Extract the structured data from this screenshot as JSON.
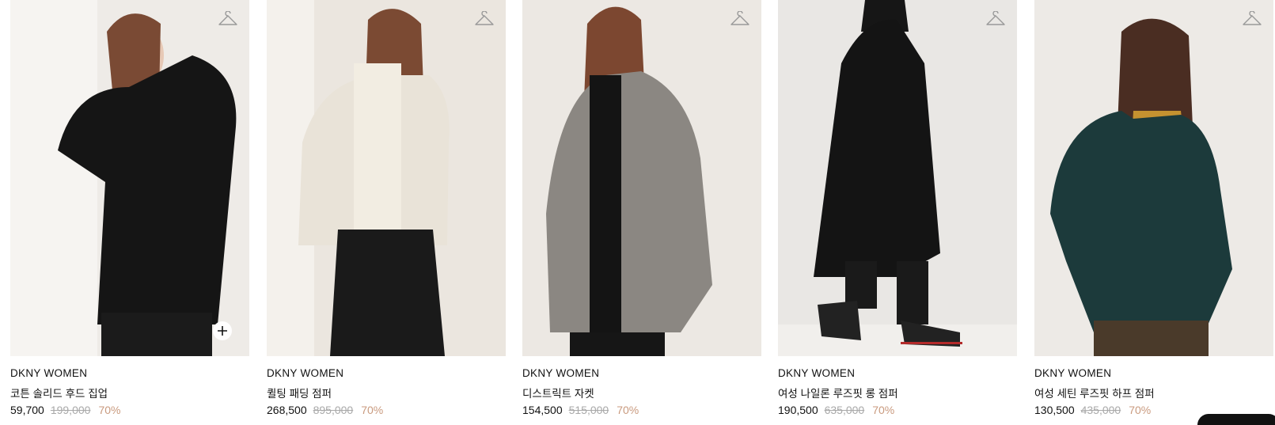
{
  "colors": {
    "sale_price": "#111111",
    "original_price": "#a9a9a9",
    "discount": "#c99a7e"
  },
  "icons": {
    "wishlist": "hanger-icon",
    "quick_add": "plus-icon"
  },
  "products": [
    {
      "brand": "DKNY WOMEN",
      "name": "코튼 솔리드 후드 집업",
      "sale_price": "59,700",
      "original_price": "199,000",
      "discount": "70%",
      "garment_color": "#151515"
    },
    {
      "brand": "DKNY WOMEN",
      "name": "퀼팅 패딩 점퍼",
      "sale_price": "268,500",
      "original_price": "895,000",
      "discount": "70%",
      "garment_color": "#e9e3d8"
    },
    {
      "brand": "DKNY WOMEN",
      "name": "디스트릭트 자켓",
      "sale_price": "154,500",
      "original_price": "515,000",
      "discount": "70%",
      "garment_color": "#8b8782"
    },
    {
      "brand": "DKNY WOMEN",
      "name": "여성 나일론 루즈핏 롱 점퍼",
      "sale_price": "190,500",
      "original_price": "635,000",
      "discount": "70%",
      "garment_color": "#141414"
    },
    {
      "brand": "DKNY WOMEN",
      "name": "여성 세틴 루즈핏 하프 점퍼",
      "sale_price": "130,500",
      "original_price": "435,000",
      "discount": "70%",
      "garment_color": "#1c3a3b"
    }
  ]
}
